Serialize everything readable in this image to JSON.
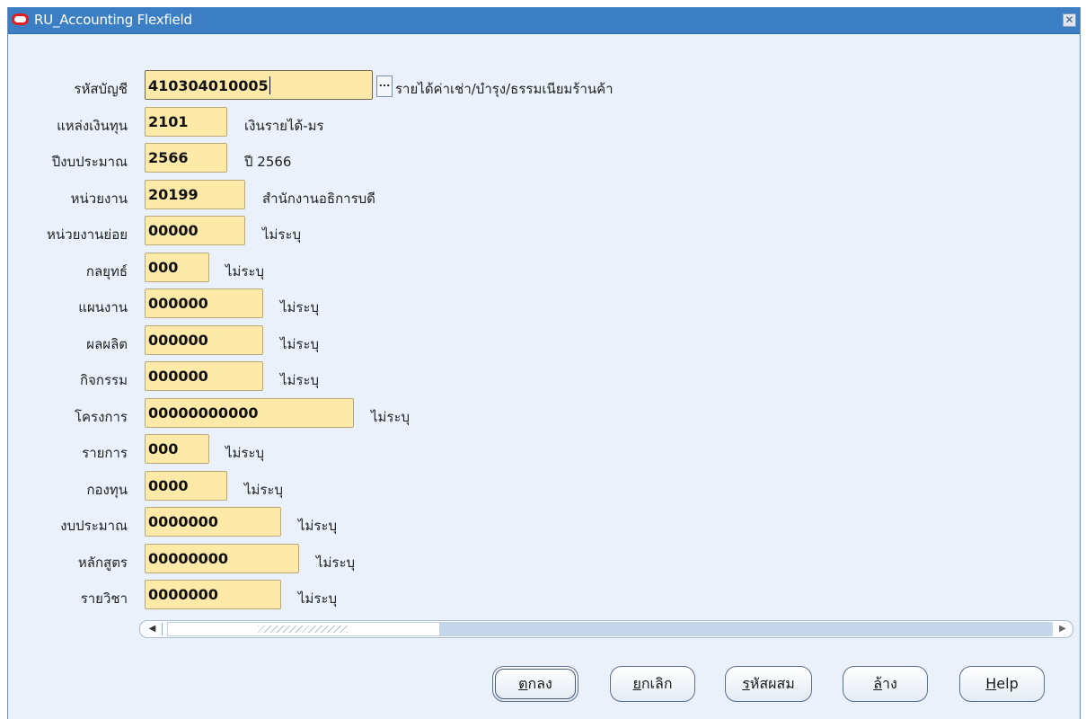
{
  "window": {
    "title": "RU_Accounting Flexfield",
    "close_glyph": "✕"
  },
  "fields": [
    {
      "label": "รหัสบัญชี",
      "value": "410304010005",
      "description": "รายได้ค่าเช่า/บำรุง/ธรรมเนียมร้านค้า"
    },
    {
      "label": "แหล่งเงินทุน",
      "value": "2101",
      "description": "เงินรายได้-มร"
    },
    {
      "label": "ปีงบประมาณ",
      "value": "2566",
      "description": "ปี 2566"
    },
    {
      "label": "หน่วยงาน",
      "value": "20199",
      "description": "สำนักงานอธิการบดี"
    },
    {
      "label": "หน่วยงานย่อย",
      "value": "00000",
      "description": "ไม่ระบุ"
    },
    {
      "label": "กลยุทธ์",
      "value": "000",
      "description": "ไม่ระบุ"
    },
    {
      "label": "แผนงาน",
      "value": "000000",
      "description": "ไม่ระบุ"
    },
    {
      "label": "ผลผลิต",
      "value": "000000",
      "description": "ไม่ระบุ"
    },
    {
      "label": "กิจกรรม",
      "value": "000000",
      "description": "ไม่ระบุ"
    },
    {
      "label": "โครงการ",
      "value": "00000000000",
      "description": "ไม่ระบุ"
    },
    {
      "label": "รายการ",
      "value": "000",
      "description": "ไม่ระบุ"
    },
    {
      "label": "กองทุน",
      "value": "0000",
      "description": "ไม่ระบุ"
    },
    {
      "label": "งบประมาณ",
      "value": "0000000",
      "description": "ไม่ระบุ"
    },
    {
      "label": "หลักสูตร",
      "value": "00000000",
      "description": "ไม่ระบุ"
    },
    {
      "label": "รายวิชา",
      "value": "0000000",
      "description": "ไม่ระบุ"
    }
  ],
  "lov_button": {
    "glyph": "..."
  },
  "scrollbar": {
    "left_arrow": "◀",
    "right_arrow": "▶"
  },
  "buttons": {
    "ok": {
      "mnemonic": "ต",
      "rest": "กลง"
    },
    "cancel": {
      "mnemonic": "ย",
      "rest": "กเลิก"
    },
    "combinations": {
      "mnemonic": "ร",
      "rest": "หัสผสม"
    },
    "clear": {
      "mnemonic": "ล",
      "rest": "้าง"
    },
    "help": {
      "mnemonic": "H",
      "rest": "elp"
    }
  },
  "colors": {
    "titlebar": "#3b7ec3",
    "window_bg": "#eaf1fb",
    "field_bg": "#fde9a8"
  }
}
